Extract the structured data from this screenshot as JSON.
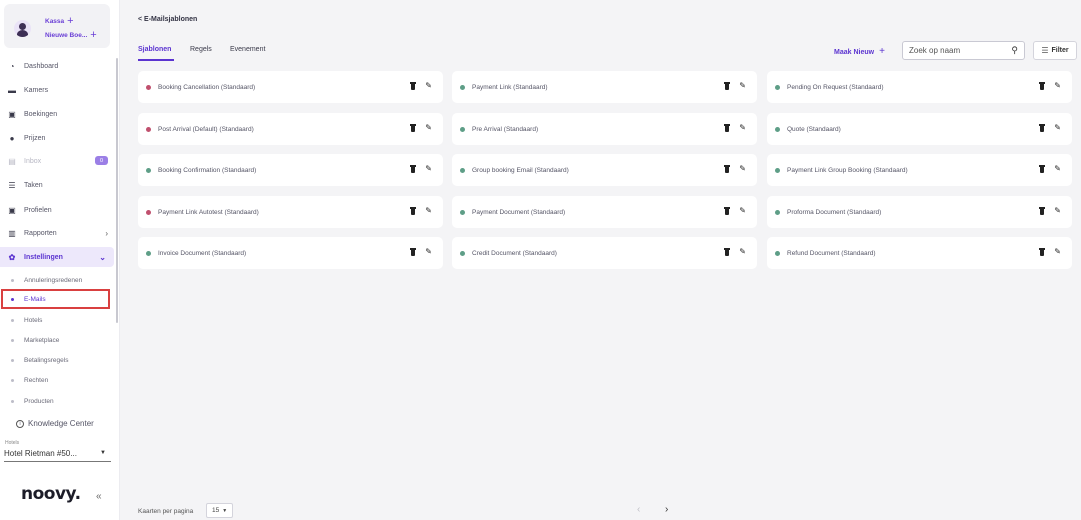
{
  "sidebar": {
    "user": {
      "kassa": "Kassa",
      "boeking": "Nieuwe Boe..."
    },
    "nav": [
      {
        "label": "Dashboard",
        "icon": "dashboard-icon"
      },
      {
        "label": "Kamers",
        "icon": "bed-icon"
      },
      {
        "label": "Boekingen",
        "icon": "calendar-icon"
      },
      {
        "label": "Prijzen",
        "icon": "price-icon"
      },
      {
        "label": "Inbox",
        "icon": "inbox-icon",
        "badge": "0",
        "disabled": true
      },
      {
        "label": "Taken",
        "icon": "tasks-icon"
      },
      {
        "label": "Profielen",
        "icon": "profile-icon"
      },
      {
        "label": "Rapporten",
        "icon": "reports-icon"
      },
      {
        "label": "Instellingen",
        "icon": "settings-icon",
        "active": true
      }
    ],
    "sub": [
      {
        "label": "Annuleringsredenen"
      },
      {
        "label": "E-Mails",
        "selected": true
      },
      {
        "label": "Hotels"
      },
      {
        "label": "Marketplace"
      },
      {
        "label": "Betalingsregels"
      },
      {
        "label": "Rechten"
      },
      {
        "label": "Producten"
      }
    ],
    "knowledge_center": "Knowledge Center",
    "hotels_label": "Hotels",
    "hotel_value": "Hotel Rietman #50...",
    "logo": "noovy."
  },
  "header": {
    "back": "< E-Mailsjablonen",
    "tabs": [
      "Sjablonen",
      "Regels",
      "Evenement"
    ],
    "active_tab": "Sjablonen",
    "new_label": "Maak Nieuw",
    "search_placeholder": "Zoek op naam",
    "filter_label": "Filter"
  },
  "colors": {
    "accent": "#5b34d0",
    "status_green": "#5e9e87",
    "status_red": "#c0506e"
  },
  "templates": [
    {
      "name": "Booking Cancellation (Standaard)",
      "status": "red"
    },
    {
      "name": "Payment Link (Standaard)",
      "status": "green"
    },
    {
      "name": "Pending On Request (Standaard)",
      "status": "green"
    },
    {
      "name": "Post Arrival (Default) (Standaard)",
      "status": "red"
    },
    {
      "name": "Pre Arrival (Standaard)",
      "status": "green"
    },
    {
      "name": "Quote (Standaard)",
      "status": "green"
    },
    {
      "name": "Booking Confirmation (Standaard)",
      "status": "green"
    },
    {
      "name": "Group booking Email (Standaard)",
      "status": "green"
    },
    {
      "name": "Payment Link Group Booking (Standaard)",
      "status": "green"
    },
    {
      "name": "Payment Link Autotest (Standaard)",
      "status": "red"
    },
    {
      "name": "Payment Document (Standaard)",
      "status": "green"
    },
    {
      "name": "Proforma Document (Standaard)",
      "status": "green"
    },
    {
      "name": "Invoice Document (Standaard)",
      "status": "green"
    },
    {
      "name": "Credit Document (Standaard)",
      "status": "green"
    },
    {
      "name": "Refund Document (Standaard)",
      "status": "green"
    }
  ],
  "pagination": {
    "label": "Kaarten per pagina",
    "value": "15"
  }
}
